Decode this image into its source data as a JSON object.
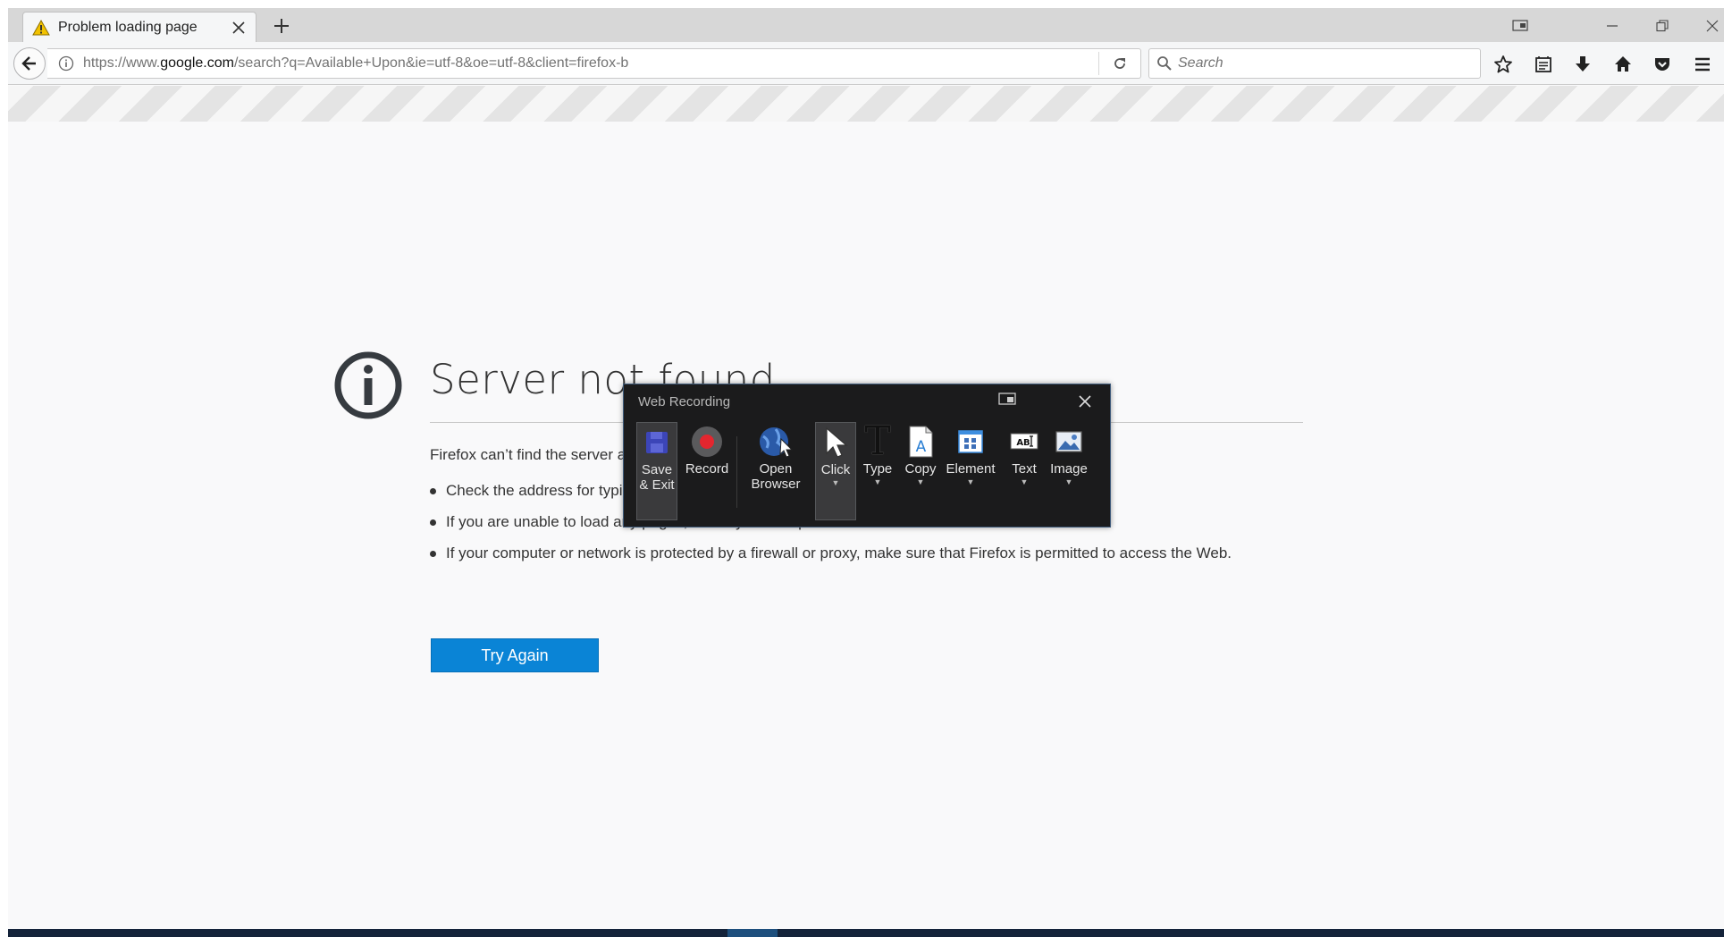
{
  "tab": {
    "title": "Problem loading page"
  },
  "navbar": {
    "url_prefix": "https://www.",
    "url_host": "google.com",
    "url_rest": "/search?q=Available+Upon&ie=utf-8&oe=utf-8&client=firefox-b",
    "search_placeholder": "Search"
  },
  "error_page": {
    "title": "Server not found",
    "description": "Firefox can’t find the server at www.google.com.",
    "suggestions": [
      "Check the address for typing errors such as ww.example.com instead of www.example.com",
      "If you are unable to load any pages, check your computer’s network connection.",
      "If your computer or network is protected by a firewall or proxy, make sure that Firefox is permitted to access the Web."
    ],
    "try_again_label": "Try Again"
  },
  "recorder": {
    "title": "Web Recording",
    "tools": {
      "save_exit": "Save\n& Exit",
      "record": "Record",
      "open_browser": "Open\nBrowser",
      "click": "Click",
      "type": "Type",
      "copy": "Copy",
      "element": "Element",
      "text": "Text",
      "image": "Image"
    }
  },
  "icons": {
    "tab": "warning-icon",
    "navigation": [
      "back-arrow-icon",
      "info-icon",
      "reload-icon",
      "search-icon"
    ],
    "toolbar": [
      "bookmark-star-icon",
      "reading-list-icon",
      "download-icon",
      "home-icon",
      "pocket-icon",
      "hamburger-menu-icon"
    ]
  },
  "colors": {
    "accent": "#0a84d6",
    "recorder_bg": "#1b1b1c",
    "record_red": "#e4262f"
  }
}
